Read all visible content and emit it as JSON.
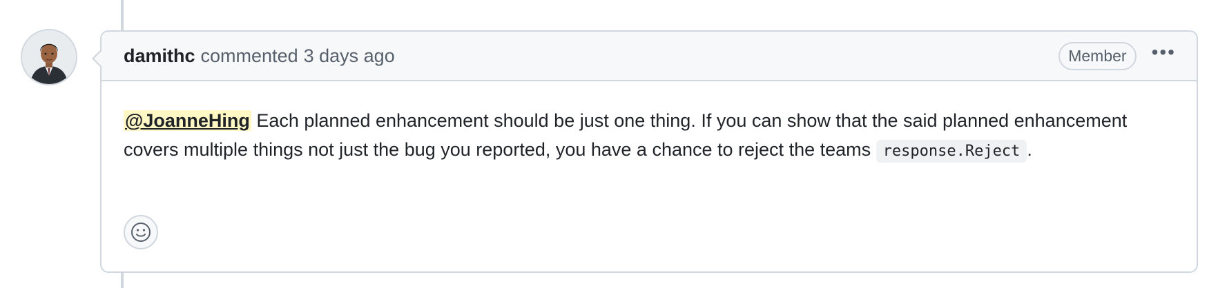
{
  "comment": {
    "author": "damithc",
    "action": "commented",
    "time": "3 days ago",
    "role_badge": "Member",
    "more_label": "•••",
    "body": {
      "mention": "@JoanneHing",
      "text_1": " Each planned enhancement should be just one thing. If you can show that the said planned enhancement covers multiple things not just the bug you reported, you have a chance to reject the teams ",
      "code": "response.Reject",
      "text_2": "."
    },
    "reaction_icon": "smiley-icon"
  },
  "colors": {
    "border": "#d0d7de",
    "header_bg": "#f6f8fa",
    "mention_bg": "#fff8c5",
    "muted_text": "#57606a",
    "text": "#1f2328"
  }
}
